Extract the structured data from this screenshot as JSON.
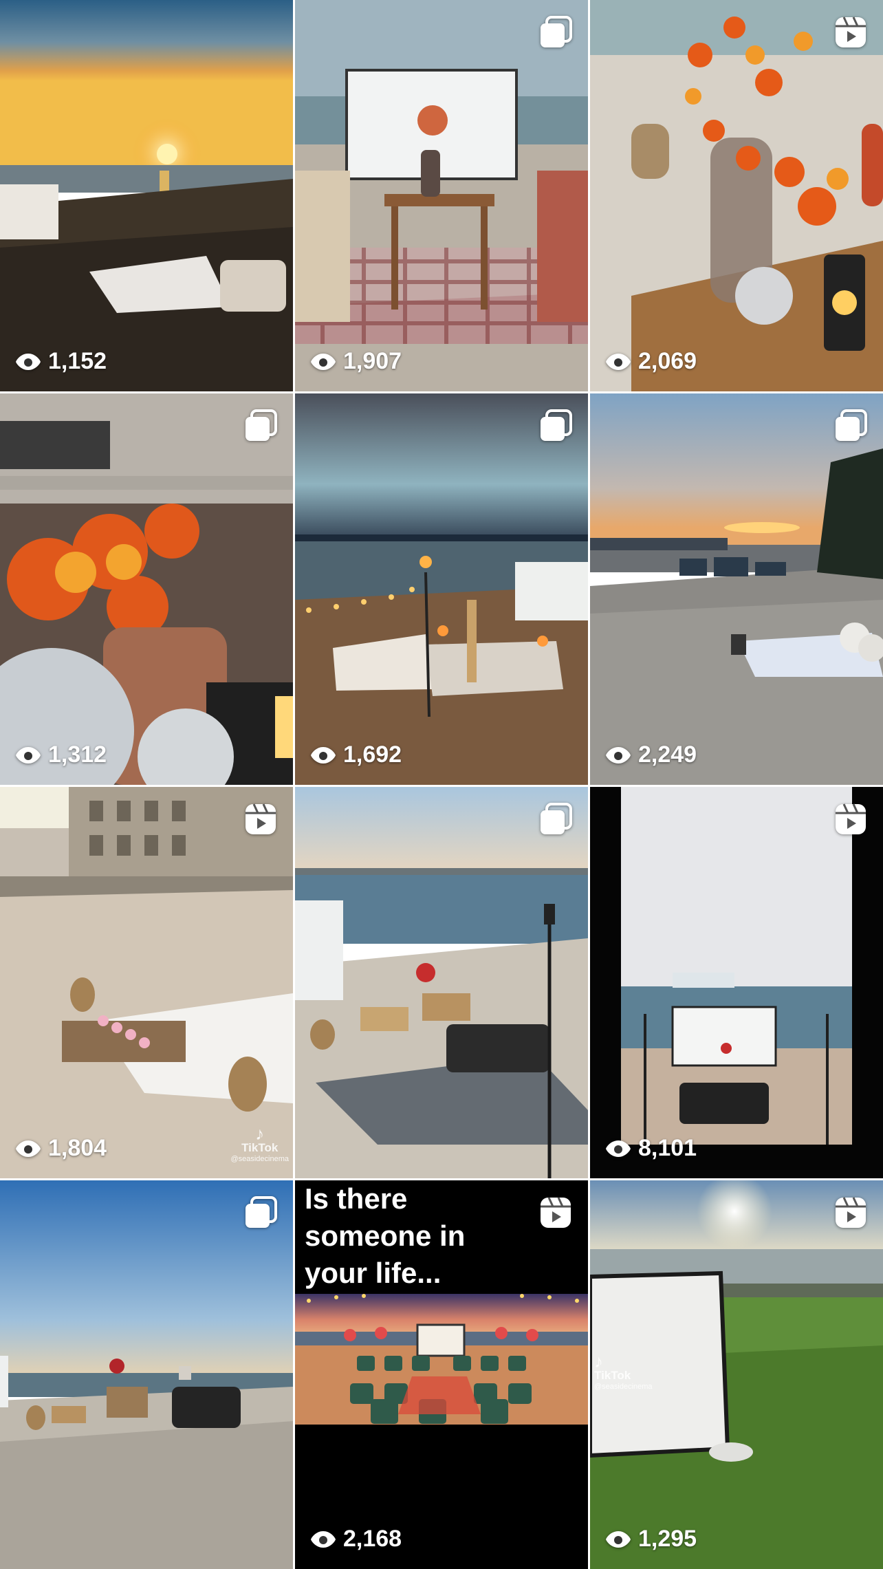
{
  "grid": {
    "posts": [
      {
        "views": "1,152",
        "badge": "none",
        "scene": "sunset-beach-picnic"
      },
      {
        "views": "1,907",
        "badge": "carousel",
        "scene": "gingham-movie-setup"
      },
      {
        "views": "2,069",
        "badge": "reel",
        "scene": "autumn-floral-table"
      },
      {
        "views": "1,312",
        "badge": "carousel",
        "scene": "disco-ball-closeup"
      },
      {
        "views": "1,692",
        "badge": "carousel",
        "scene": "night-beach-lights"
      },
      {
        "views": "2,249",
        "badge": "carousel",
        "scene": "evening-blanket-setup"
      },
      {
        "views": "1,804",
        "badge": "reel",
        "scene": "golden-beach-setup",
        "watermark": {
          "brand": "TikTok",
          "handle": "@seasidecinema"
        }
      },
      {
        "views": "",
        "badge": "carousel",
        "scene": "daytime-beach-chairs"
      },
      {
        "views": "8,101",
        "badge": "reel",
        "scene": "screen-on-beach"
      },
      {
        "views": "",
        "badge": "carousel",
        "scene": "roses-table-beach"
      },
      {
        "views": "2,168",
        "badge": "reel",
        "scene": "birthday-movie-night",
        "caption": "Is there someone in your life..."
      },
      {
        "views": "1,295",
        "badge": "reel",
        "scene": "grass-screen",
        "watermark": {
          "brand": "TikTok",
          "handle": "@seasidecinema"
        }
      }
    ]
  }
}
